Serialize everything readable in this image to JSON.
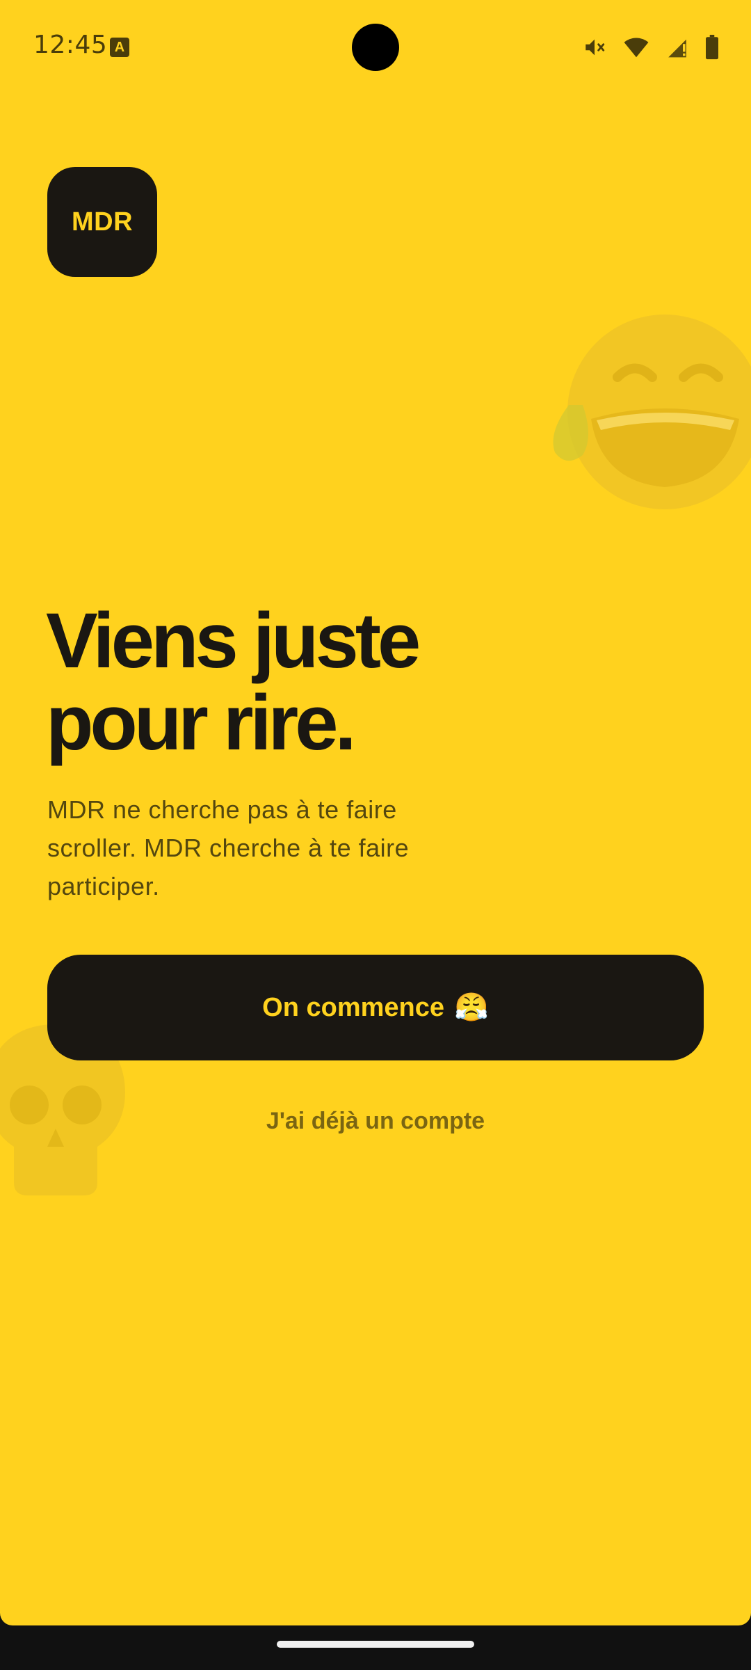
{
  "status_bar": {
    "time": "12:45",
    "notification_icon": "a-icon",
    "icons": [
      "mute-icon",
      "wifi-icon",
      "signal-icon",
      "battery-icon"
    ]
  },
  "logo": {
    "text": "MDR"
  },
  "decorations": [
    "laughing-tears-emoji",
    "skull-emoji"
  ],
  "headline": {
    "line1": "Viens juste",
    "line2": "pour rire."
  },
  "subtitle": "MDR ne cherche pas à te faire scroller. MDR cherche à te faire participer.",
  "primary_button": {
    "label": "On commence",
    "emoji": "😤"
  },
  "secondary_link": {
    "label": "J'ai déjà un compte"
  },
  "colors": {
    "background": "#FFD21E",
    "dark": "#1A1712",
    "muted_text": "#54470F",
    "link_text": "#7A6512"
  }
}
